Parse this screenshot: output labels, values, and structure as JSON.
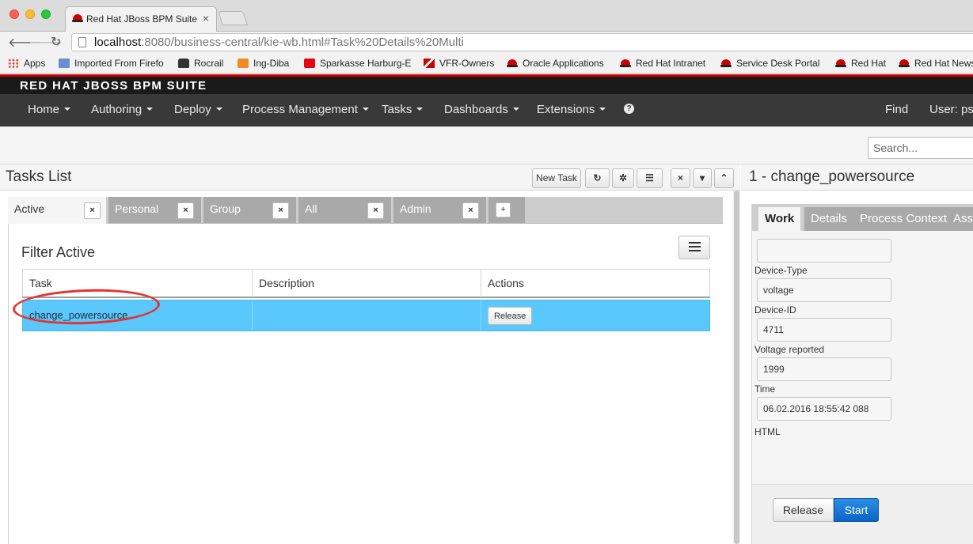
{
  "browser": {
    "tab_title": "Red Hat JBoss BPM Suite",
    "tab_close": "×",
    "url_host": "localhost",
    "url_rest": ":8080/business-central/kie-wb.html#Task%20Details%20Multi",
    "bookmarks": [
      {
        "label": "Apps",
        "icon": "apps-icon"
      },
      {
        "label": "Imported From Firefo",
        "icon": "folder-icon"
      },
      {
        "label": "Rocrail",
        "icon": "train-icon"
      },
      {
        "label": "Ing-Diba",
        "icon": "lion-icon"
      },
      {
        "label": "Sparkasse Harburg-E",
        "icon": "sparkasse-icon"
      },
      {
        "label": "VFR-Owners",
        "icon": "vfr-icon"
      },
      {
        "label": "Oracle Applications",
        "icon": "redhat-icon"
      },
      {
        "label": "Red Hat Intranet",
        "icon": "redhat-icon"
      },
      {
        "label": "Service Desk Portal",
        "icon": "redhat-icon"
      },
      {
        "label": "Red Hat",
        "icon": "redhat-icon"
      },
      {
        "label": "Red Hat News",
        "icon": "redhat-icon"
      }
    ]
  },
  "app": {
    "brand": "RED HAT JBOSS BPM SUITE",
    "nav": [
      {
        "label": "Home"
      },
      {
        "label": "Authoring"
      },
      {
        "label": "Deploy"
      },
      {
        "label": "Process Management"
      },
      {
        "label": "Tasks"
      },
      {
        "label": "Dashboards"
      },
      {
        "label": "Extensions"
      }
    ],
    "help_glyph": "?",
    "find_label": "Find",
    "user_label": "User: pst",
    "search_placeholder": "Search..."
  },
  "tasks_panel": {
    "title": "Tasks List",
    "new_task_label": "New Task",
    "icons": {
      "refresh": "↻",
      "settings": "✲",
      "list": "☰",
      "close": "×",
      "dropdown": "▾",
      "collapse": "⌃"
    },
    "filter_tabs": [
      {
        "label": "Active",
        "active": true
      },
      {
        "label": "Personal",
        "active": false
      },
      {
        "label": "Group",
        "active": false
      },
      {
        "label": "All",
        "active": false
      },
      {
        "label": "Admin",
        "active": false
      }
    ],
    "tab_close_glyph": "×",
    "add_tab_glyph": "+",
    "filter_title": "Filter Active",
    "columns": [
      "Task",
      "Description",
      "Actions"
    ],
    "rows": [
      {
        "task": "change_powersource",
        "description": "",
        "action": "Release"
      }
    ]
  },
  "details_panel": {
    "title": "1 - change_powersource",
    "tabs": [
      {
        "label": "Work",
        "active": true
      },
      {
        "label": "Details",
        "active": false
      },
      {
        "label": "Process Context",
        "active": false
      },
      {
        "label": "Assi",
        "active": false
      }
    ],
    "top_field_value": "",
    "fields": [
      {
        "label": "Device-Type",
        "value": "voltage"
      },
      {
        "label": "Device-ID",
        "value": "4711"
      },
      {
        "label": "Voltage reported",
        "value": "1999"
      },
      {
        "label": "Time",
        "value": "06.02.2016 18:55:42 088"
      }
    ],
    "html_label": "HTML",
    "release_label": "Release",
    "start_label": "Start"
  },
  "colors": {
    "selected_row": "#5bc8fd",
    "brand_red": "#cc0000",
    "primary_button": "#0a64c8"
  }
}
